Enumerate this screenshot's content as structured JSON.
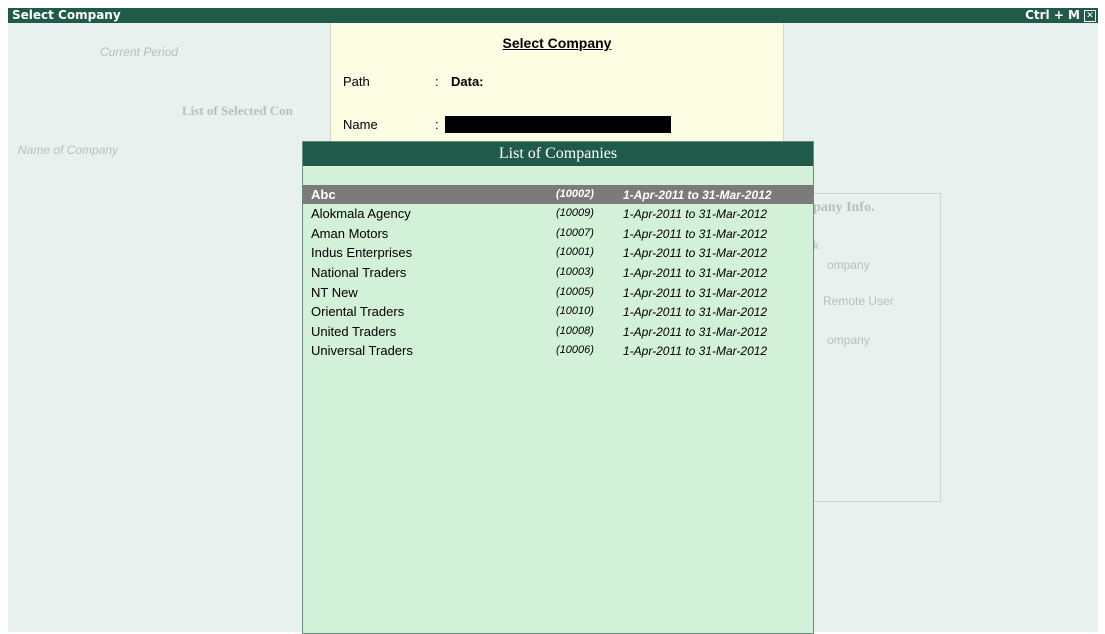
{
  "window": {
    "title": "Select Company",
    "shortcut": "Ctrl + M",
    "close_glyph": "✕"
  },
  "background": {
    "current_period_label": "Current Period",
    "list_of_selected_label": "List of Selected Con",
    "name_of_company_label": "Name of Company",
    "company_info_label": "pany Info.",
    "info_line1": "k",
    "info_line2": "ompany",
    "info_line3": "Remote User",
    "info_line4": "ompany"
  },
  "select_panel": {
    "title": "Select Company",
    "path_label": "Path",
    "path_value": "Data:",
    "name_label": "Name",
    "colon": ":"
  },
  "list_popup": {
    "header": "List of Companies",
    "companies": [
      {
        "name": "Abc",
        "code": "(10002)",
        "period": "1-Apr-2011 to 31-Mar-2012",
        "selected": true
      },
      {
        "name": "Alokmala Agency",
        "code": "(10009)",
        "period": "1-Apr-2011 to 31-Mar-2012",
        "selected": false
      },
      {
        "name": "Aman Motors",
        "code": "(10007)",
        "period": "1-Apr-2011 to 31-Mar-2012",
        "selected": false
      },
      {
        "name": "Indus Enterprises",
        "code": "(10001)",
        "period": "1-Apr-2011 to 31-Mar-2012",
        "selected": false
      },
      {
        "name": "National Traders",
        "code": "(10003)",
        "period": "1-Apr-2011 to 31-Mar-2012",
        "selected": false
      },
      {
        "name": "NT New",
        "code": "(10005)",
        "period": "1-Apr-2011 to 31-Mar-2012",
        "selected": false
      },
      {
        "name": "Oriental Traders",
        "code": "(10010)",
        "period": "1-Apr-2011 to 31-Mar-2012",
        "selected": false
      },
      {
        "name": "United Traders",
        "code": "(10008)",
        "period": "1-Apr-2011 to 31-Mar-2012",
        "selected": false
      },
      {
        "name": "Universal Traders",
        "code": "(10006)",
        "period": "1-Apr-2011 to 31-Mar-2012",
        "selected": false
      }
    ]
  },
  "colors": {
    "title_bar": "#205b4a",
    "list_bg": "#d3f0d8",
    "selected_row": "#7b7b7b",
    "select_panel_bg": "#fdfde3"
  }
}
